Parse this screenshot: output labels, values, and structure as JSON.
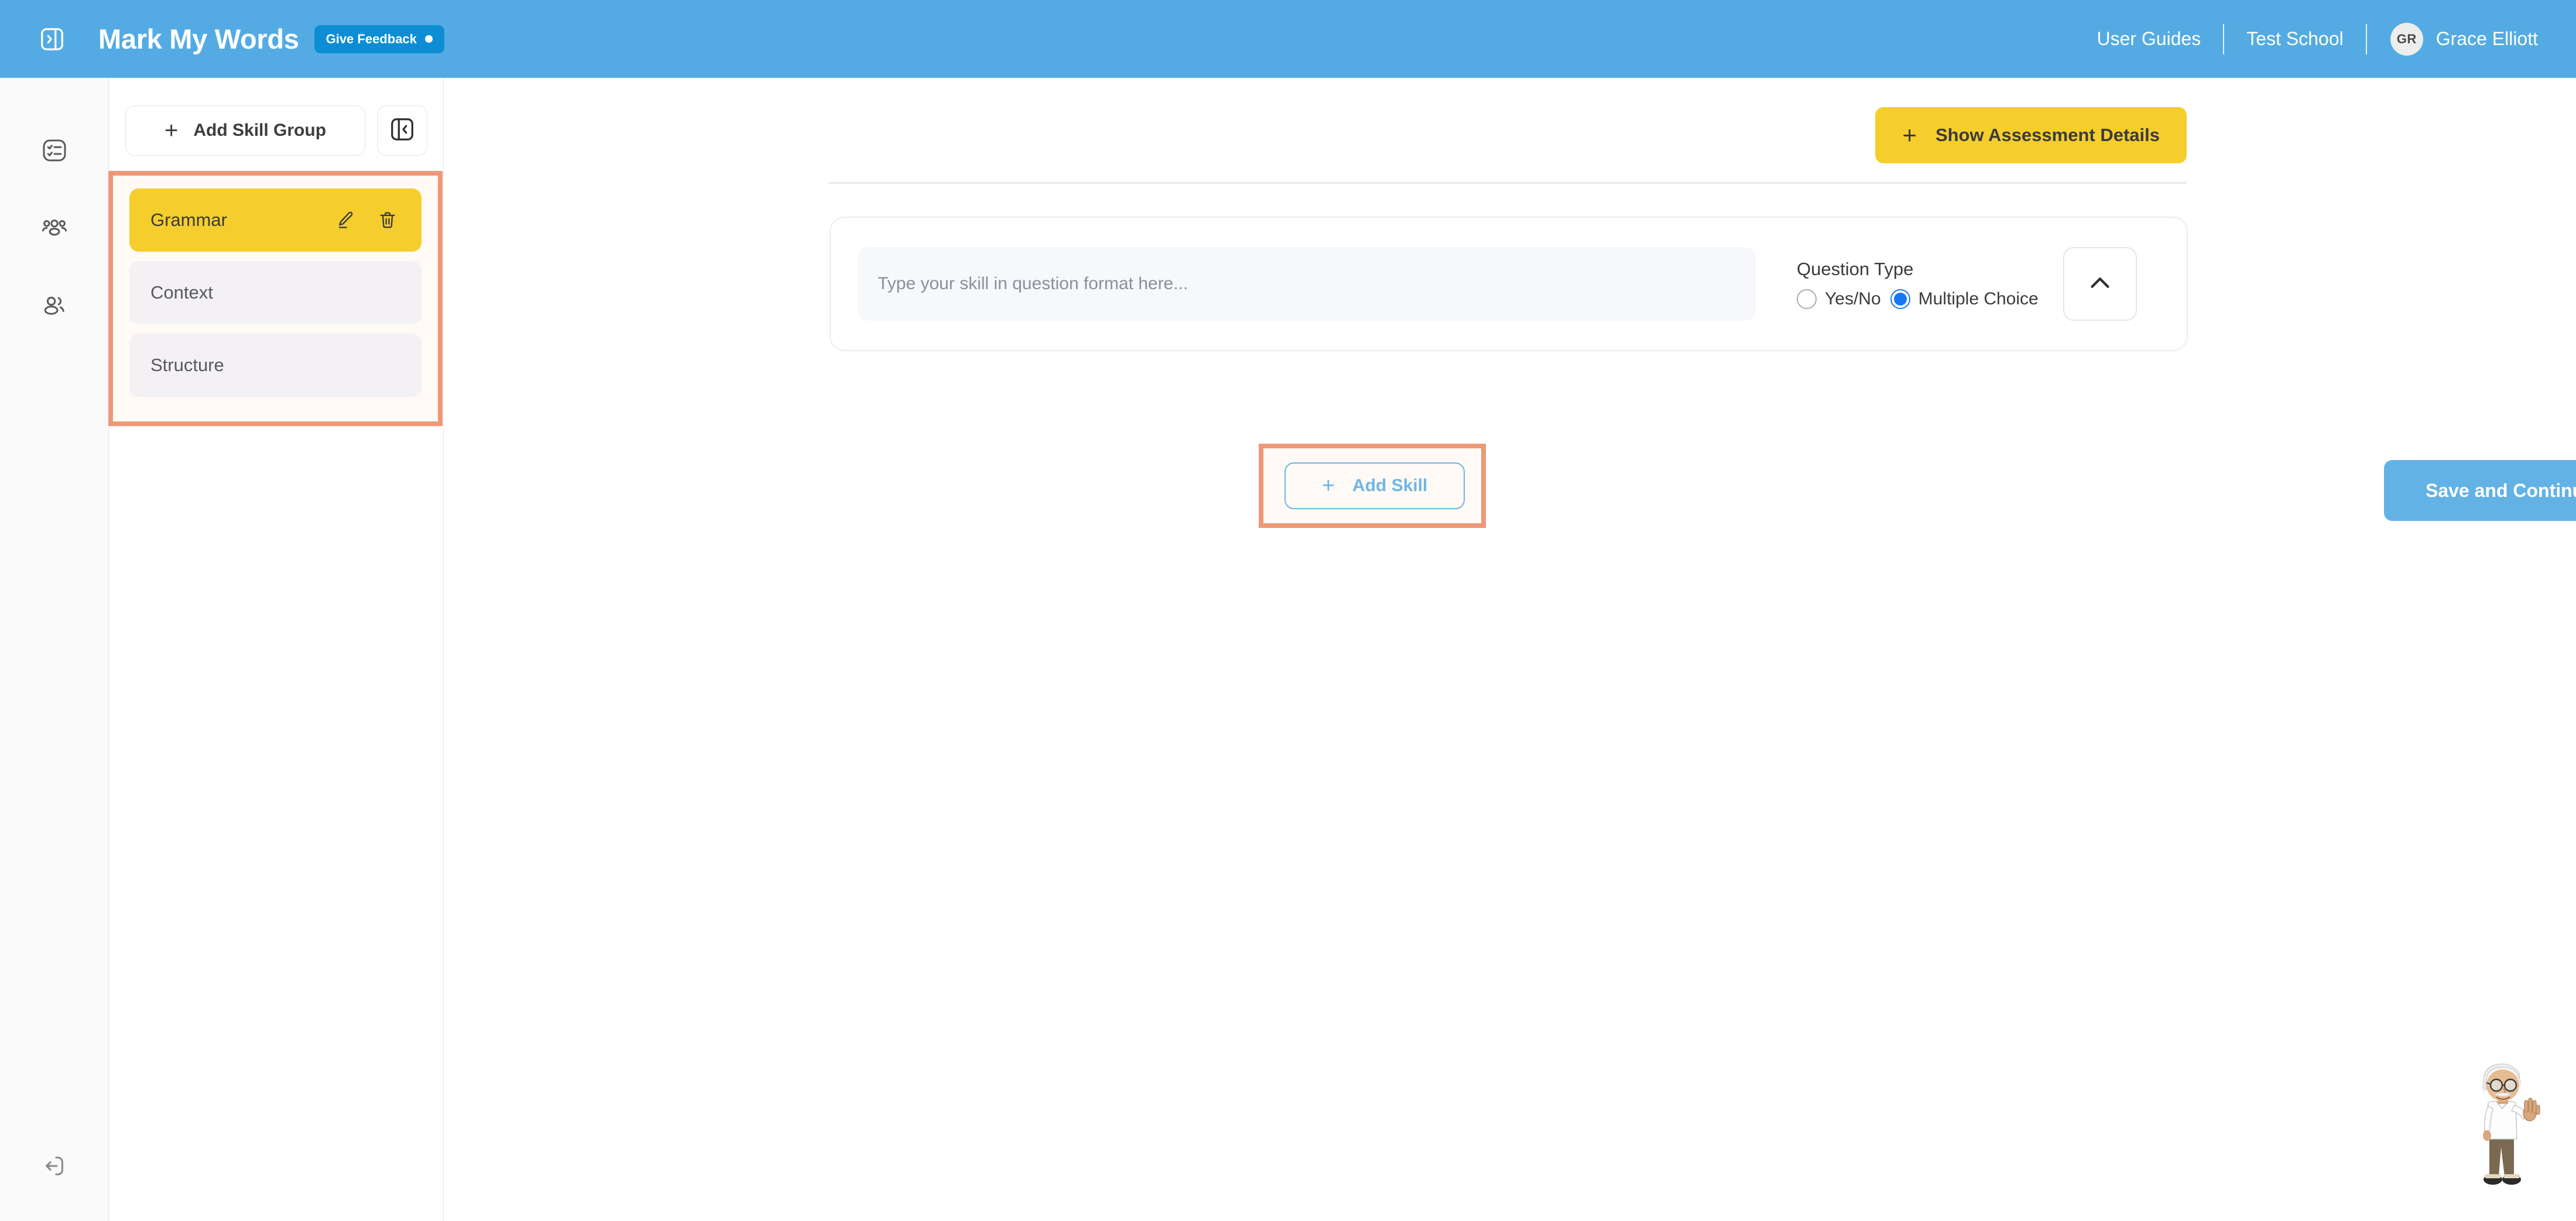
{
  "header": {
    "collapse_icon": "panel-expand-icon",
    "app_title": "Mark My Words",
    "feedback_badge": {
      "label": "Give Feedback",
      "dot": "notification-dot"
    },
    "links": [
      {
        "label": "User Guides"
      },
      {
        "label": "Test School"
      }
    ],
    "user": {
      "initials": "GR",
      "name": "Grace Elliott"
    },
    "brand_color": "#54ABE3",
    "feedback_color": "#0D8DD4"
  },
  "icon_rail": {
    "items": [
      {
        "name": "assessments",
        "icon": "checklist-icon"
      },
      {
        "name": "classes",
        "icon": "users-group-icon"
      },
      {
        "name": "students",
        "icon": "people-icon"
      }
    ],
    "logout": {
      "name": "logout",
      "icon": "logout-icon"
    }
  },
  "skill_panel": {
    "add_group_button": {
      "plus": "+",
      "label": "Add Skill Group"
    },
    "collapse_button_icon": "panel-collapse-icon",
    "groups": [
      {
        "name": "Grammar",
        "active": true,
        "edit_icon": "pencil-icon",
        "delete_icon": "trash-icon"
      },
      {
        "name": "Context",
        "active": false
      },
      {
        "name": "Structure",
        "active": false
      }
    ],
    "active_color": "#F5CE2E",
    "inactive_color": "#F4F1F4",
    "highlight_color": "#EE9878"
  },
  "main": {
    "show_details_button": {
      "plus": "+",
      "label": "Show Assessment Details"
    },
    "skill_card": {
      "question_input": {
        "value": "",
        "placeholder": "Type your skill in question format here..."
      },
      "question_type": {
        "label": "Question Type",
        "options": [
          {
            "label": "Yes/No",
            "selected": false
          },
          {
            "label": "Multiple Choice",
            "selected": true
          }
        ],
        "selected_color": "#1976F2"
      },
      "collapse_icon": "chevron-up-icon"
    },
    "add_skill_button": {
      "plus": "+",
      "label": "Add Skill",
      "color": "#6FB6E4"
    },
    "save_button": {
      "label": "Save and Continue",
      "color": "#62B2E6"
    }
  },
  "mascot": {
    "name": "professor-mascot"
  }
}
